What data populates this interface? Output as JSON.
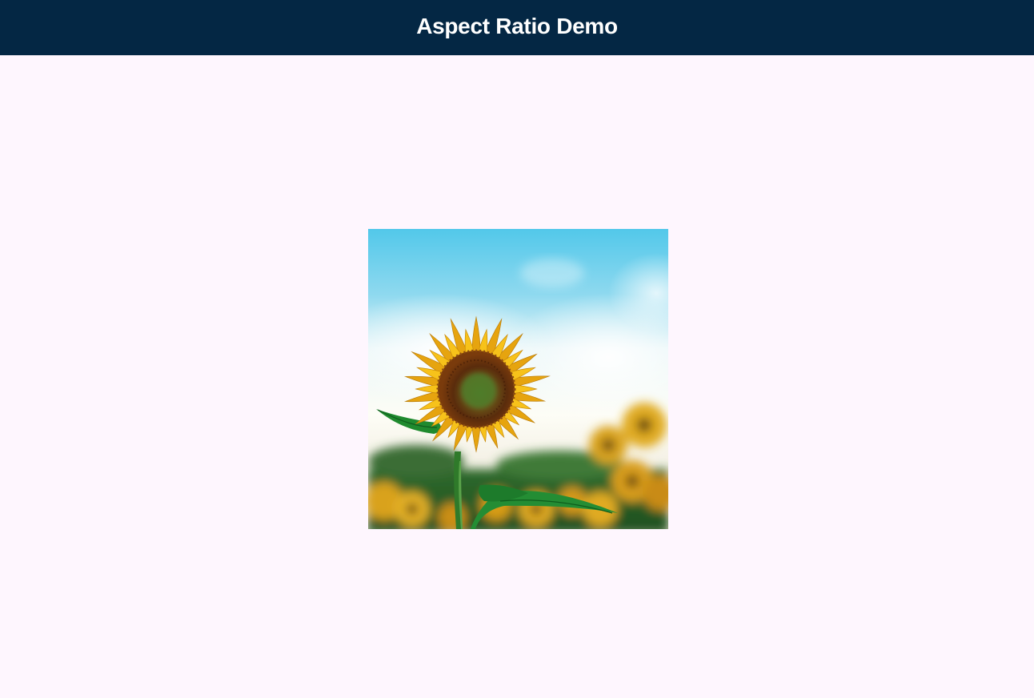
{
  "app_bar": {
    "title": "Aspect Ratio Demo",
    "background_color": "#042744",
    "title_color": "#ffffff"
  },
  "page": {
    "background_color": "#fef6fe"
  },
  "image": {
    "subject": "sunflower-photo",
    "aspect_ratio": "1:1"
  }
}
